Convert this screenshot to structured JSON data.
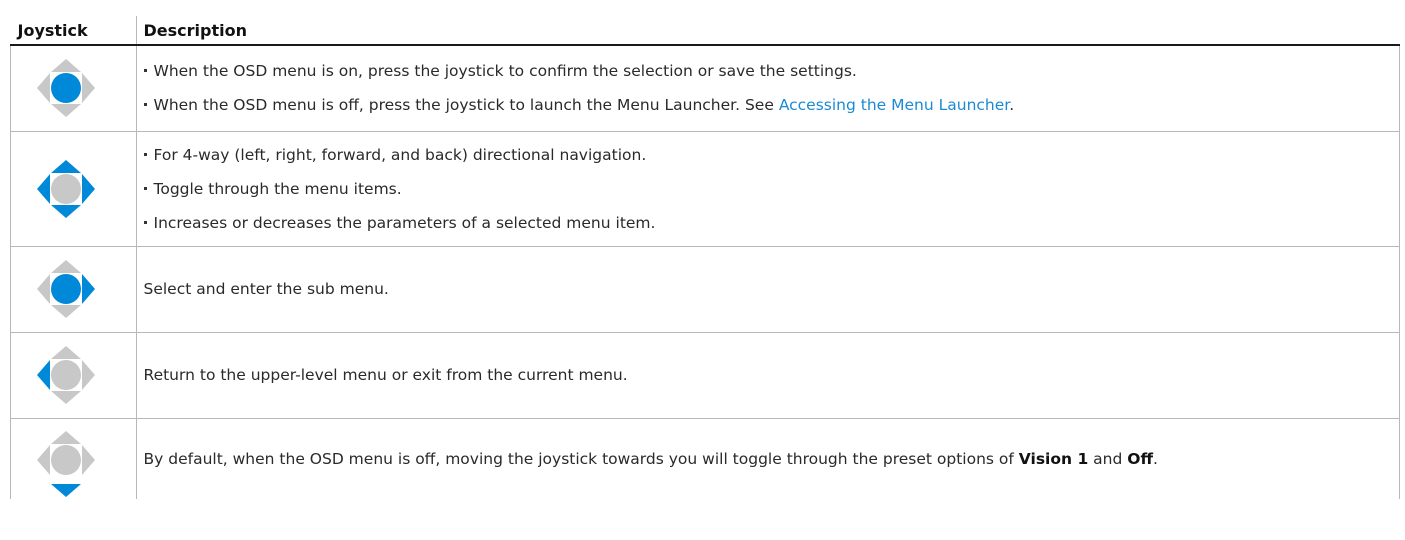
{
  "table": {
    "headers": {
      "joystick": "Joystick",
      "description": "Description"
    },
    "colors": {
      "active": "#0089d9",
      "inactive": "#c8c8c8",
      "link": "#1a8ad6"
    },
    "rows": [
      {
        "icon": "joystick-press-icon",
        "bullets": [
          "When the OSD menu is on, press the joystick to confirm the selection or save the settings.",
          "When the OSD menu is off, press the joystick to launch the Menu Launcher. See "
        ],
        "link": "Accessing the Menu Launcher",
        "link_suffix": "."
      },
      {
        "icon": "joystick-4-way-icon",
        "bullets": [
          "For 4-way (left, right, forward, and back) directional navigation.",
          "Toggle through the menu items.",
          "Increases or decreases the parameters of a selected menu item."
        ]
      },
      {
        "icon": "joystick-right-icon",
        "text": "Select and enter the sub menu."
      },
      {
        "icon": "joystick-left-icon",
        "text": "Return to the upper-level menu or exit from the current menu."
      },
      {
        "icon": "joystick-down-icon",
        "text_parts": [
          "By default, when the OSD menu is off, moving the joystick towards you will toggle through the preset options of ",
          "Vision 1",
          " and ",
          "Off",
          "."
        ]
      }
    ]
  }
}
